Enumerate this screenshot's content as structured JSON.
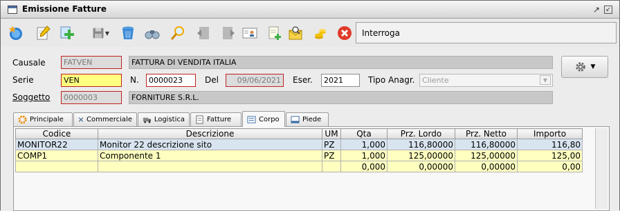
{
  "window": {
    "title": "Emissione Fatture"
  },
  "toolbar": {
    "search_text": "Interroga",
    "icons": [
      "new-star-icon",
      "edit-pencil-icon",
      "add-plus-icon",
      "save-disk-icon",
      "delete-bin-icon",
      "binoculars-icon",
      "magnifier-icon",
      "prev-record-icon",
      "next-record-icon",
      "card-person-icon",
      "document-add-icon",
      "envelope-search-icon",
      "coins-icon",
      "close-red-icon"
    ]
  },
  "form": {
    "causale": {
      "label": "Causale",
      "code": "FATVEN",
      "description": "FATTURA DI VENDITA ITALIA"
    },
    "serie": {
      "label": "Serie",
      "value": "VEN"
    },
    "numero": {
      "label": "N.",
      "value": "0000023"
    },
    "del": {
      "label": "Del",
      "value": "09/06/2021"
    },
    "eser": {
      "label": "Eser.",
      "value": "2021"
    },
    "tipo_anagr": {
      "label": "Tipo Anagr.",
      "value": "Cliente"
    },
    "soggetto": {
      "label": "Soggetto",
      "code": "0000003",
      "description": "FORNITURE S.R.L."
    }
  },
  "tabs": [
    {
      "label": "Principale",
      "icon": "gear-orange-icon",
      "active": false
    },
    {
      "label": "Commerciale",
      "icon": "tools-icon",
      "active": false
    },
    {
      "label": "Logistica",
      "icon": "truck-icon",
      "active": false
    },
    {
      "label": "Fatture",
      "icon": "document-icon",
      "active": false
    },
    {
      "label": "Corpo",
      "icon": "list-icon",
      "active": true
    },
    {
      "label": "Piede",
      "icon": "footer-icon",
      "active": false
    }
  ],
  "grid": {
    "columns": [
      "Codice",
      "Descrizione",
      "UM",
      "Qta",
      "Prz. Lordo",
      "Prz. Netto",
      "Importo"
    ],
    "rows": [
      [
        "MONITOR22",
        "Monitor 22 descrizione sito",
        "PZ",
        "1,000",
        "116,80000",
        "116,80000",
        "116,80"
      ],
      [
        "COMP1",
        "Componente 1",
        "PZ",
        "1,000",
        "125,00000",
        "125,00000",
        "125,00"
      ],
      [
        "",
        "",
        "",
        "0,000",
        "0,00000",
        "0,00000",
        "0,00"
      ]
    ]
  },
  "colors": {
    "highlight_row": "#d8e4f0",
    "editable_row": "#ffffc0",
    "required_border": "#c02020",
    "active_field": "#ffff80"
  }
}
